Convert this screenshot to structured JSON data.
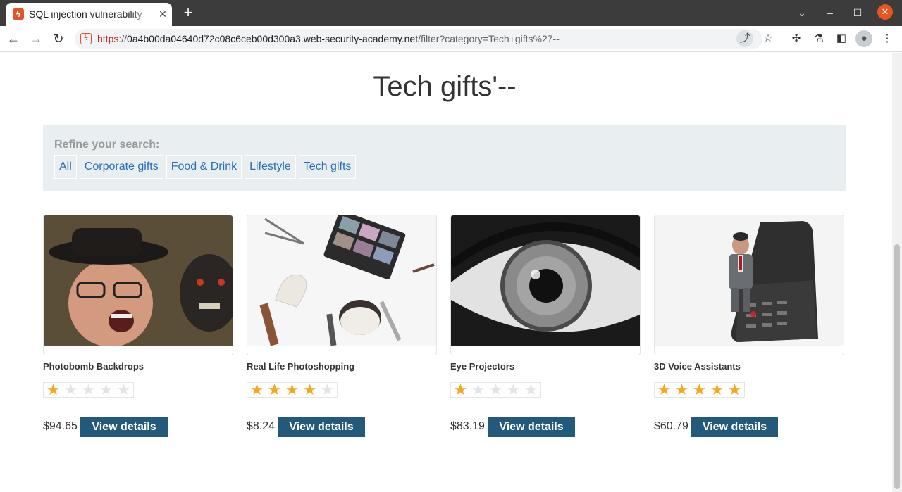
{
  "browser": {
    "tab_title": "SQL injection vulnerability",
    "url_scheme": "https",
    "url_sep": "://",
    "url_host": "0a4b00da04640d72c08c6ceb00d300a3.web-security-academy.net",
    "url_path": "/filter?category=Tech+gifts%27--"
  },
  "page": {
    "heading": "Tech gifts'--",
    "filter_label": "Refine your search:",
    "categories": [
      "All",
      "Corporate gifts",
      "Food & Drink",
      "Lifestyle",
      "Tech gifts"
    ]
  },
  "products": [
    {
      "name": "Photobomb Backdrops",
      "rating": 1,
      "price": "$94.65",
      "button": "View details"
    },
    {
      "name": "Real Life Photoshopping",
      "rating": 4,
      "price": "$8.24",
      "button": "View details"
    },
    {
      "name": "Eye Projectors",
      "rating": 1,
      "price": "$83.19",
      "button": "View details"
    },
    {
      "name": "3D Voice Assistants",
      "rating": 5,
      "price": "$60.79",
      "button": "View details"
    }
  ],
  "colors": {
    "accent_button": "#23597a",
    "link": "#2a6fb5",
    "star_on": "#f4a81d",
    "filter_bg": "#e9eef1"
  }
}
